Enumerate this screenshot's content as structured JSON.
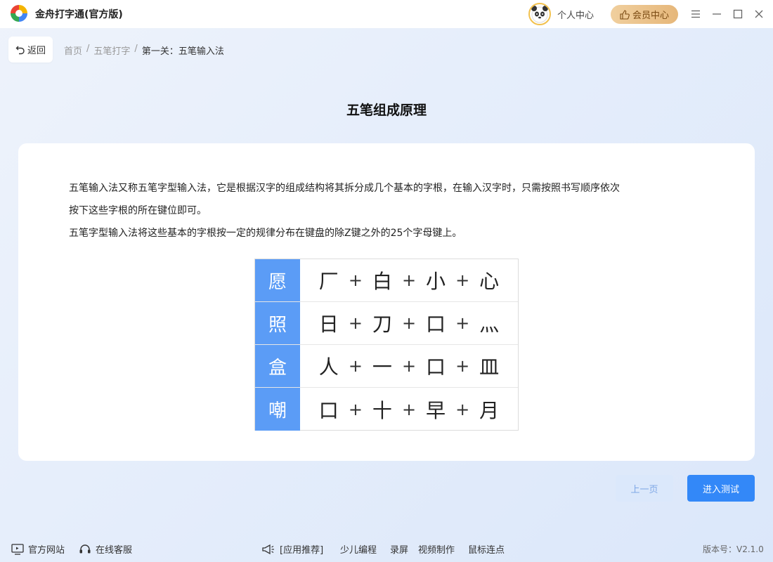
{
  "titlebar": {
    "app_title": "金舟打字通(官方版)",
    "personal_center": "个人中心",
    "vip_center": "会员中心"
  },
  "nav": {
    "back_label": "返回",
    "breadcrumb": [
      "首页",
      "五笔打字",
      "第一关：五笔输入法"
    ]
  },
  "page": {
    "title": "五笔组成原理",
    "para1_line1": "五笔输入法又称五笔字型输入法，它是根据汉字的组成结构将其拆分成几个基本的字根，在输入汉字时，只需按照书写顺序依次",
    "para1_line2": "按下这些字根的所在键位即可。",
    "para2": "五笔字型输入法将这些基本的字根按一定的规律分布在键盘的除Z键之外的25个字母键上。"
  },
  "decomposition": [
    {
      "char": "愿",
      "parts": [
        "厂",
        "白",
        "小",
        "心"
      ]
    },
    {
      "char": "照",
      "parts": [
        "日",
        "刀",
        "口",
        "灬"
      ]
    },
    {
      "char": "盒",
      "parts": [
        "人",
        "一",
        "口",
        "皿"
      ]
    },
    {
      "char": "嘲",
      "parts": [
        "口",
        "十",
        "早",
        "月"
      ]
    }
  ],
  "buttons": {
    "prev": "上一页",
    "next": "进入测试"
  },
  "footer": {
    "website": "官方网站",
    "service": "在线客服",
    "recommend": "[应用推荐]",
    "links": [
      "少儿编程",
      "录屏",
      "视频制作",
      "鼠标连点"
    ],
    "version": "版本号：V2.1.0"
  },
  "colors": {
    "accent": "#3388f8",
    "key_cell": "#5b9cf6",
    "vip_gold": "#e6b77a"
  }
}
